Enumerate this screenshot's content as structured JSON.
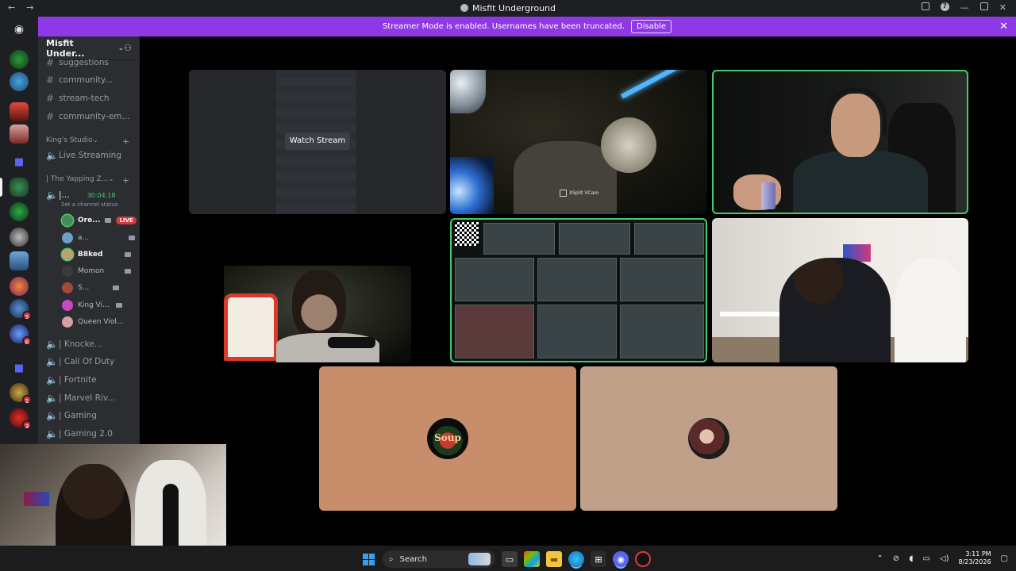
{
  "window": {
    "title": "Misfit Underground"
  },
  "banner": {
    "text": "Streamer Mode is enabled. Usernames have been truncated.",
    "button_label": "Disable"
  },
  "guild": {
    "name": "Misfit Under..."
  },
  "channels": {
    "text": [
      {
        "label": "suggestions"
      },
      {
        "label": "community..."
      },
      {
        "label": "stream-tech"
      },
      {
        "label": "community-em..."
      }
    ],
    "category_kings_studio": "King's Studio",
    "live_streaming": "Live Streaming",
    "yapping_zone": "| The Yapping Z...",
    "active_user": "|...",
    "active_timer": "30:04:18",
    "channel_status": "Set a channel status",
    "voice_users": [
      {
        "name": "Ore...",
        "live": "LIVE"
      },
      {
        "name": "a..."
      },
      {
        "name": "B8ked"
      },
      {
        "name": "Momon"
      },
      {
        "name": "S..."
      },
      {
        "name": "King Vi..."
      },
      {
        "name": "Queen Viol..."
      }
    ],
    "voice_channels": [
      {
        "label": "| Knocke..."
      },
      {
        "label": "| Call Of Duty"
      },
      {
        "label": "| Fortnite"
      },
      {
        "label": "| Marvel Riv..."
      },
      {
        "label": "| Gaming"
      },
      {
        "label": "| Gaming 2.0"
      }
    ]
  },
  "servers": {
    "badges": [
      "5",
      "6",
      "1",
      "3"
    ]
  },
  "stage": {
    "watch_stream_label": "Watch Stream",
    "xsplit_label": "XSplit VCam",
    "soup_avatar_text": "Soup"
  },
  "taskbar": {
    "search_label": "Search",
    "time": "3:11 PM",
    "date": "8/23/2026"
  },
  "colors": {
    "banner": "#8f39e6",
    "speaking_border": "#49c96e",
    "live_badge": "#da373c",
    "tile_audio_1": "#c88e6b",
    "tile_audio_2": "#c1a08a"
  }
}
